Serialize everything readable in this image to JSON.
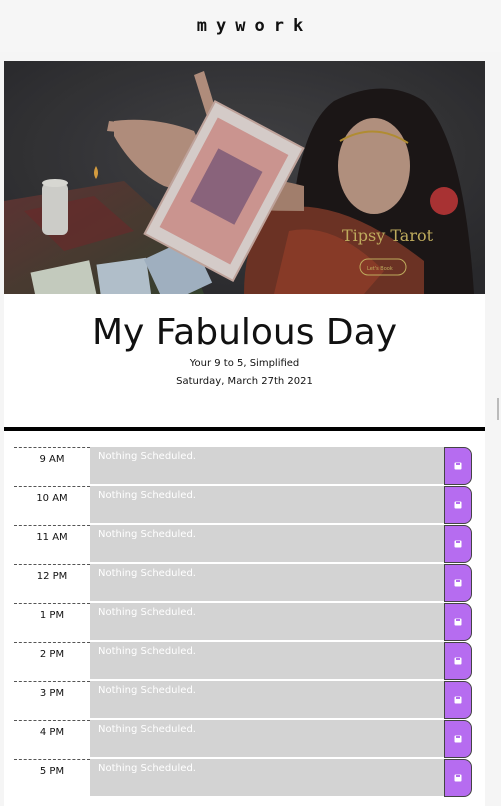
{
  "header": {
    "brand": "mywork"
  },
  "hero": {
    "logo_text": "Tipsy Tarot",
    "cta_label": "Let's Book"
  },
  "jumbotron": {
    "title": "My Fabulous Day",
    "subtitle": "Your 9 to 5, Simplified",
    "current_date": "Saturday, March 27th 2021"
  },
  "schedule": {
    "placeholder": "Nothing Scheduled.",
    "hours": [
      {
        "label": "9 AM",
        "text": "Nothing Scheduled."
      },
      {
        "label": "10 AM",
        "text": "Nothing Scheduled."
      },
      {
        "label": "11 AM",
        "text": "Nothing Scheduled."
      },
      {
        "label": "12 PM",
        "text": "Nothing Scheduled."
      },
      {
        "label": "1 PM",
        "text": "Nothing Scheduled."
      },
      {
        "label": "2 PM",
        "text": "Nothing Scheduled."
      },
      {
        "label": "3 PM",
        "text": "Nothing Scheduled."
      },
      {
        "label": "4 PM",
        "text": "Nothing Scheduled."
      },
      {
        "label": "5 PM",
        "text": "Nothing Scheduled."
      }
    ],
    "save_icon": "save-icon"
  },
  "colors": {
    "save_button": "#b66cf0",
    "row_background": "#d3d3d3",
    "logo_gold": "#d9c36a"
  }
}
